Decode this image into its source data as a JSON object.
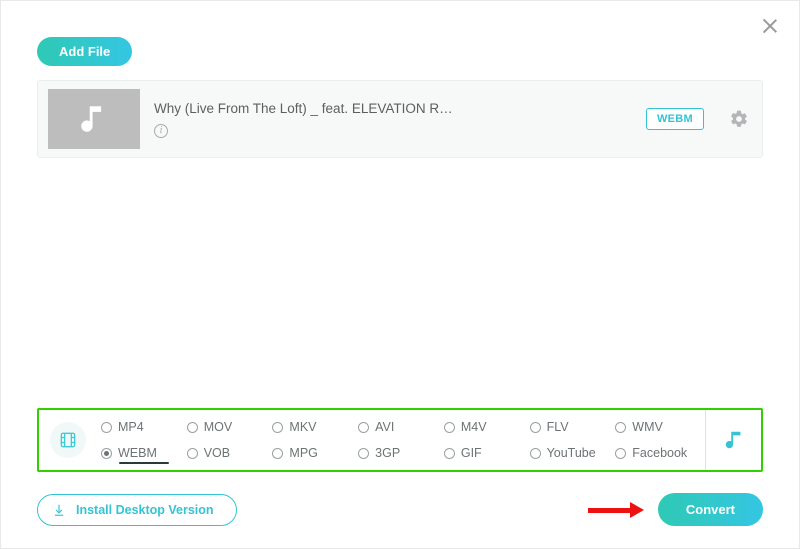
{
  "buttons": {
    "add_file": "Add File",
    "install_desktop": "Install Desktop Version",
    "convert": "Convert"
  },
  "file": {
    "title": "Why (Live From The Loft) _ feat. ELEVATION R…",
    "badge": "WEBM"
  },
  "formats": {
    "selected": "WEBM",
    "row1": [
      "MP4",
      "MOV",
      "MKV",
      "AVI",
      "M4V",
      "FLV",
      "WMV"
    ],
    "row2": [
      "WEBM",
      "VOB",
      "MPG",
      "3GP",
      "GIF",
      "YouTube",
      "Facebook"
    ]
  }
}
